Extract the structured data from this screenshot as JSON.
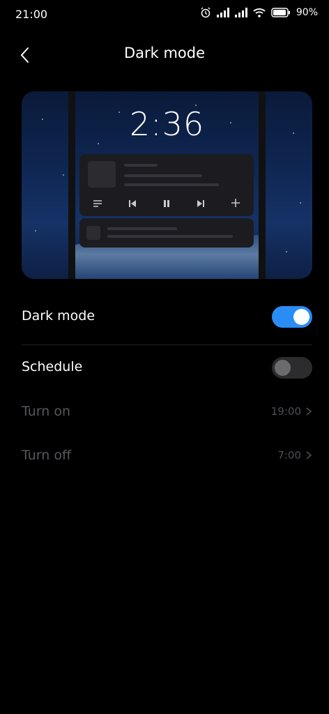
{
  "status_bar": {
    "time": "21:00",
    "battery": "90%",
    "icons": [
      "alarm-icon",
      "signal-icon",
      "signal-icon",
      "wifi-icon",
      "battery-icon"
    ]
  },
  "header": {
    "title": "Dark mode",
    "back_icon": "chevron-left-icon"
  },
  "preview": {
    "clock": "2:36",
    "media_icons": [
      "list-icon",
      "previous-icon",
      "pause-icon",
      "next-icon",
      "plus-icon"
    ]
  },
  "settings": {
    "dark_mode": {
      "label": "Dark mode",
      "enabled": true
    },
    "schedule": {
      "label": "Schedule",
      "enabled": false
    },
    "turn_on": {
      "label": "Turn on",
      "value": "19:00"
    },
    "turn_off": {
      "label": "Turn off",
      "value": "7:00"
    }
  },
  "colors": {
    "accent": "#2a8df5",
    "background": "#000000",
    "dim_text": "#55575c"
  }
}
